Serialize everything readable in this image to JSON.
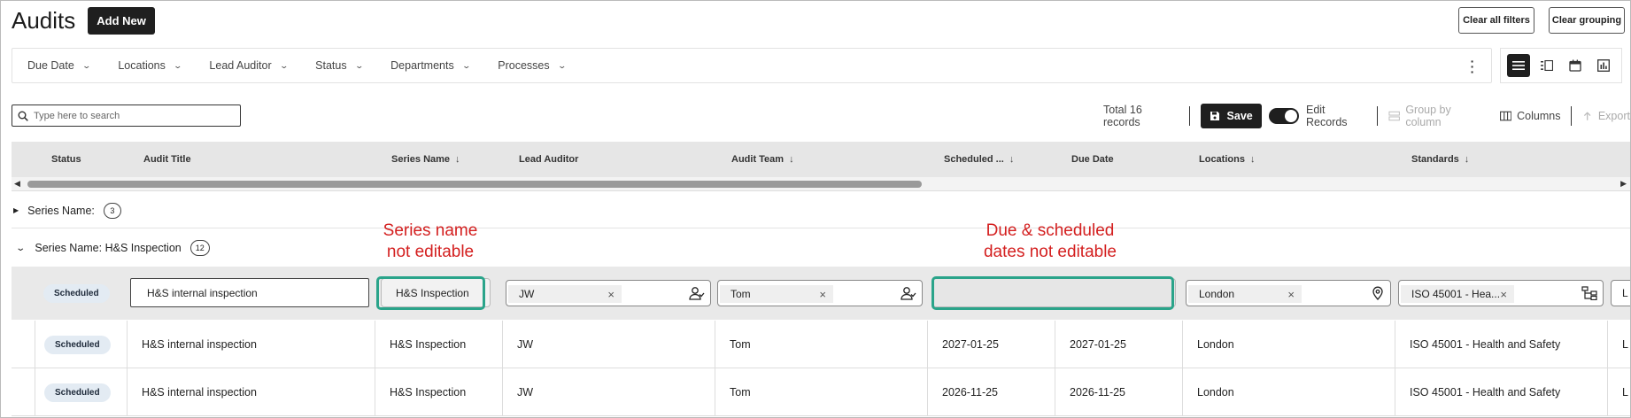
{
  "page": {
    "title": "Audits",
    "add_new": "Add New",
    "clear_all_filters": "Clear all filters",
    "clear_grouping": "Clear grouping"
  },
  "filters": [
    "Due Date",
    "Locations",
    "Lead Auditor",
    "Status",
    "Departments",
    "Processes"
  ],
  "search": {
    "placeholder": "Type here to search"
  },
  "toolbar": {
    "total": "Total 16 records",
    "save": "Save",
    "edit_records": "Edit Records",
    "group_by_column": "Group by column",
    "columns": "Columns",
    "export": "Export"
  },
  "columns": [
    "Status",
    "Audit Title",
    "Series Name",
    "Lead Auditor",
    "Audit Team",
    "Scheduled ...",
    "Due Date",
    "Locations",
    "Standards"
  ],
  "groups": {
    "g1": {
      "label": "Series Name:",
      "count": "3"
    },
    "g2": {
      "label": "Series Name: H&S Inspection",
      "count": "12"
    }
  },
  "edit_row": {
    "status": "Scheduled",
    "audit_title": "H&S internal inspection",
    "series_name": "H&S Inspection",
    "lead_auditor": "JW",
    "audit_team": "Tom",
    "location": "London",
    "standard": "ISO 45001 - Hea...",
    "next_col": "L"
  },
  "annotations": {
    "series": "Series name\nnot editable",
    "dates": "Due & scheduled\ndates not editable"
  },
  "rows": [
    {
      "status": "Scheduled",
      "title": "H&S internal inspection",
      "series": "H&S Inspection",
      "lead": "JW",
      "team": "Tom",
      "scheduled": "2027-01-25",
      "due": "2027-01-25",
      "location": "London",
      "standard": "ISO 45001 - Health and Safety",
      "next": "L"
    },
    {
      "status": "Scheduled",
      "title": "H&S internal inspection",
      "series": "H&S Inspection",
      "lead": "JW",
      "team": "Tom",
      "scheduled": "2026-11-25",
      "due": "2026-11-25",
      "location": "London",
      "standard": "ISO 45001 - Health and Safety",
      "next": "L"
    }
  ],
  "colors": {
    "teal_highlight": "#2aa48a",
    "annotation_red": "#d42020",
    "dark": "#1f1f1f",
    "status_badge": "#e3ebf3"
  }
}
